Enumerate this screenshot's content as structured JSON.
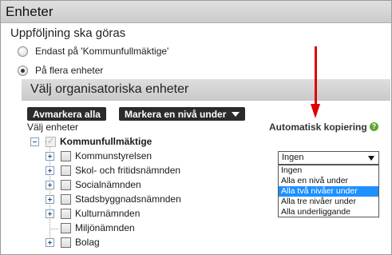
{
  "header": {
    "title": "Enheter"
  },
  "followup": {
    "title": "Uppföljning ska göras",
    "options": [
      {
        "label": "Endast på 'Kommunfullmäktige'",
        "checked": false
      },
      {
        "label": "På flera enheter",
        "checked": true
      }
    ]
  },
  "org_section": {
    "title": "Välj organisatoriska enheter"
  },
  "buttons": {
    "deselect_all": "Avmarkera alla",
    "select_level_below": "Markera en nivå under"
  },
  "tree": {
    "label": "Välj enheter",
    "root": "Kommunfullmäktige",
    "children": [
      {
        "label": "Kommunstyrelsen",
        "expandable": true
      },
      {
        "label": "Skol- och fritidsnämnden",
        "expandable": true
      },
      {
        "label": "Socialnämnden",
        "expandable": true
      },
      {
        "label": "Stadsbyggnadsnämnden",
        "expandable": true
      },
      {
        "label": "Kulturnämnden",
        "expandable": true
      },
      {
        "label": "Miljönämnden",
        "expandable": false
      },
      {
        "label": "Bolag",
        "expandable": true
      }
    ]
  },
  "auto_copy": {
    "label": "Automatisk kopiering",
    "help_icon": "?",
    "selected": "Ingen",
    "options": [
      "Ingen",
      "Alla en nivå under",
      "Alla två nivåer under",
      "Alla tre nivåer under",
      "Alla underliggande"
    ],
    "highlighted": "Alla två nivåer under"
  },
  "colors": {
    "arrow": "#e00000",
    "highlight": "#1e90ff",
    "help": "#5ea62e"
  }
}
